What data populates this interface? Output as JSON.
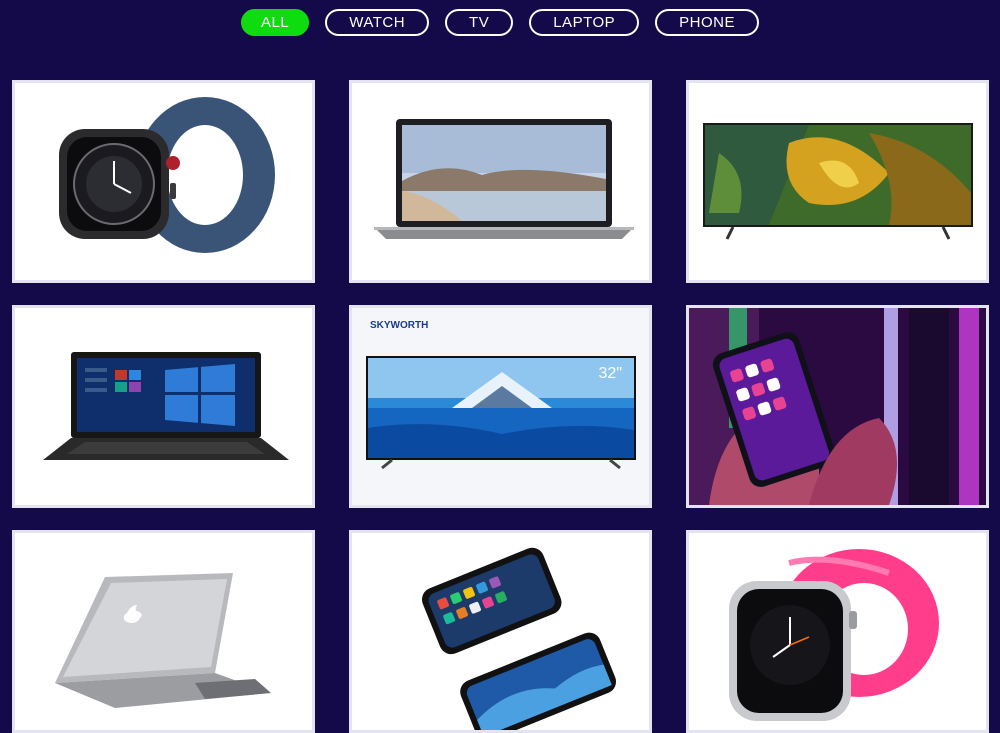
{
  "filters": [
    {
      "label": "ALL",
      "active": true
    },
    {
      "label": "WATCH",
      "active": false
    },
    {
      "label": "TV",
      "active": false
    },
    {
      "label": "LAPTOP",
      "active": false
    },
    {
      "label": "PHONE",
      "active": false
    }
  ],
  "products": [
    {
      "category": "watch",
      "icon": "smartwatch-blue-band-image"
    },
    {
      "category": "laptop",
      "icon": "laptop-silver-image"
    },
    {
      "category": "tv",
      "icon": "tv-colorful-screen-image"
    },
    {
      "category": "laptop",
      "icon": "laptop-black-windows-image"
    },
    {
      "category": "tv",
      "icon": "tv-skyworth-image",
      "brand": "SKYWORTH",
      "size_label": "32\""
    },
    {
      "category": "phone",
      "icon": "phone-in-hand-image"
    },
    {
      "category": "laptop",
      "icon": "macbook-silver-image"
    },
    {
      "category": "phone",
      "icon": "iphone-pair-image"
    },
    {
      "category": "watch",
      "icon": "smartwatch-pink-band-image"
    }
  ],
  "colors": {
    "background": "#140a4a",
    "active_filter": "#0fdc0f",
    "filter_border": "#ffffff"
  }
}
